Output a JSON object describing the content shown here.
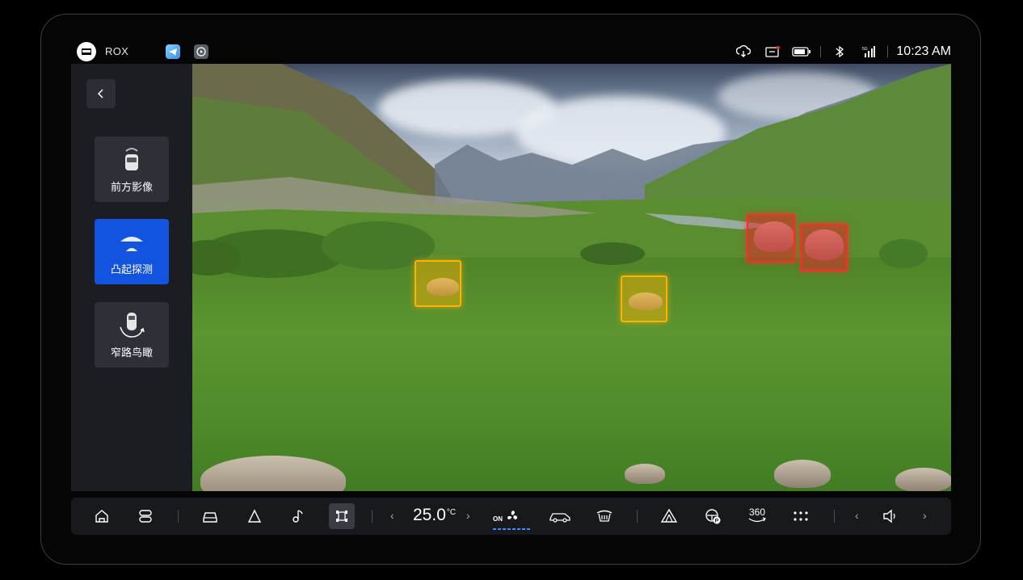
{
  "status_bar": {
    "brand": "ROX",
    "time": "10:23 AM",
    "icons": [
      "cloud-download-icon",
      "message-icon",
      "battery-icon",
      "bluetooth-icon",
      "signal-5g-icon"
    ]
  },
  "sidebar": {
    "back_icon": "chevron-left-icon",
    "modes": [
      {
        "label": "前方影像",
        "icon": "front-camera-car-icon",
        "active": false
      },
      {
        "label": "凸起探测",
        "icon": "bump-detect-icon",
        "active": true
      },
      {
        "label": "窄路鸟瞰",
        "icon": "narrow-road-birdview-icon",
        "active": false
      }
    ]
  },
  "camera_view": {
    "detections": [
      {
        "level": "warning",
        "color": "#ffb000"
      },
      {
        "level": "warning",
        "color": "#ffb000"
      },
      {
        "level": "danger",
        "color": "#ff2a2a"
      },
      {
        "level": "danger",
        "color": "#ff2a2a"
      }
    ]
  },
  "dock": {
    "temperature": "25.0",
    "temp_unit": "°C",
    "fan_label": "ON",
    "label_360": "360",
    "icons": [
      "home-icon",
      "toggle-icon",
      "car-icon",
      "navigation-icon",
      "music-icon",
      "offroad-camera-icon",
      "fan-icon",
      "car-side-icon",
      "defrost-icon",
      "tent-icon",
      "steering-p-icon",
      "view-360-icon",
      "apps-icon",
      "volume-icon"
    ]
  },
  "colors": {
    "accent": "#1253e0",
    "warning": "#ffb000",
    "danger": "#ff2a2a"
  }
}
